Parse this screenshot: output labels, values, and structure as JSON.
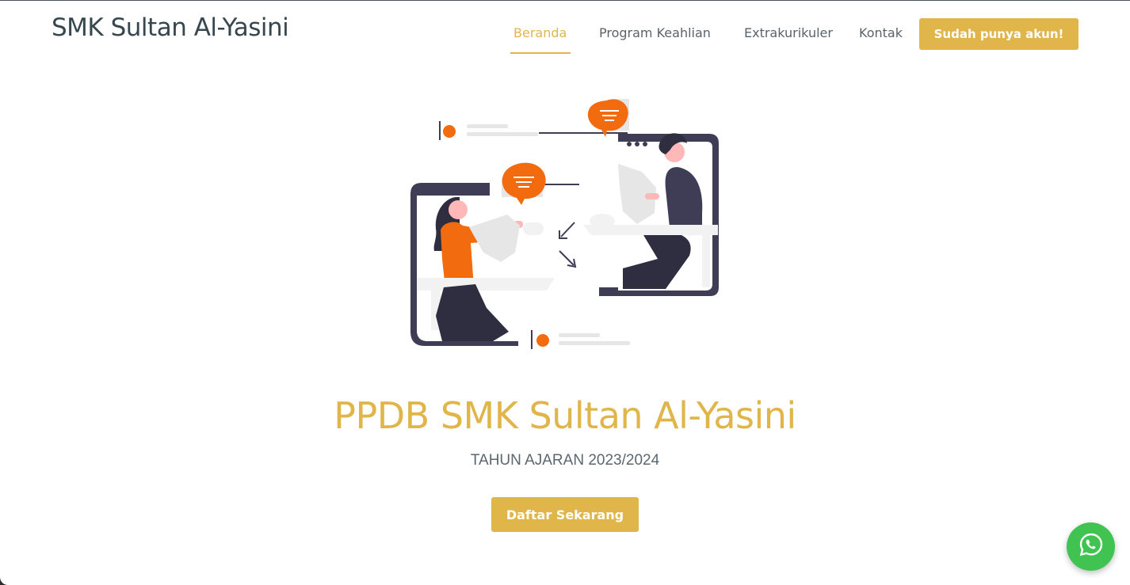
{
  "brand": {
    "name": "SMK Sultan Al-Yasini"
  },
  "nav": {
    "items": [
      {
        "label": "Beranda"
      },
      {
        "label": "Program Keahlian"
      },
      {
        "label": "Extrakurikuler"
      },
      {
        "label": "Kontak"
      }
    ],
    "active": "Beranda",
    "account_button": "Sudah punya akun!"
  },
  "hero": {
    "illustration_icon": "online-meeting-illustration",
    "title": "PPDB SMK Sultan Al-Yasini",
    "subtitle": "TAHUN AJARAN 2023/2024",
    "cta": "Daftar Sekarang"
  },
  "whatsapp": {
    "icon": "whatsapp-icon"
  },
  "colors": {
    "accent": "#e0b64a",
    "illustration_orange": "#f26b0f",
    "illustration_dark": "#3f3d56",
    "whatsapp_green": "#40c351"
  }
}
